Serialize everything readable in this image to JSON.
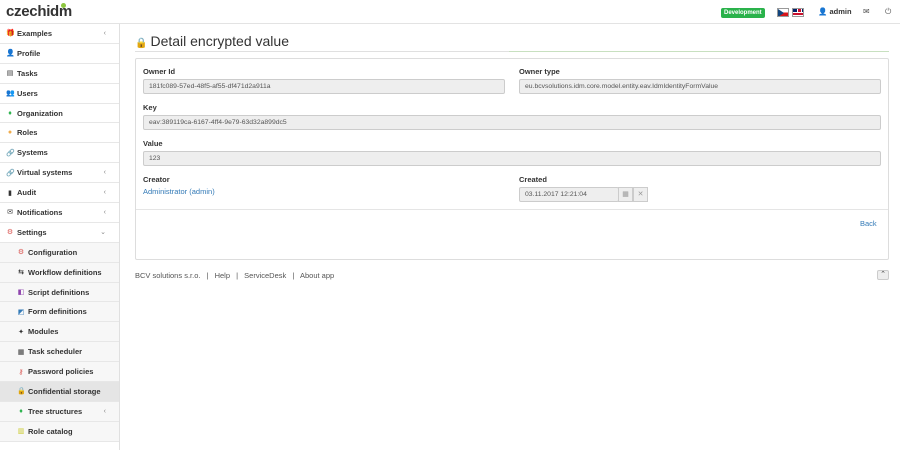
{
  "brand": {
    "logo_text": "czechidm"
  },
  "header": {
    "environment_badge": "Development",
    "user": "admin"
  },
  "sidebar": {
    "items": [
      {
        "label": "Examples",
        "icon": "gift-icon",
        "chevron": "‹"
      },
      {
        "label": "Profile",
        "icon": "user-icon",
        "chevron": ""
      },
      {
        "label": "Tasks",
        "icon": "tasks-icon",
        "chevron": ""
      },
      {
        "label": "Users",
        "icon": "users-icon",
        "chevron": ""
      },
      {
        "label": "Organization",
        "icon": "tree-icon",
        "chevron": ""
      },
      {
        "label": "Roles",
        "icon": "role-icon",
        "chevron": ""
      },
      {
        "label": "Systems",
        "icon": "link-icon",
        "chevron": ""
      },
      {
        "label": "Virtual systems",
        "icon": "link-icon",
        "chevron": "‹"
      },
      {
        "label": "Audit",
        "icon": "chart-icon",
        "chevron": "‹"
      },
      {
        "label": "Notifications",
        "icon": "envelope-icon",
        "chevron": "‹"
      },
      {
        "label": "Settings",
        "icon": "gear-icon",
        "chevron": "⌄"
      }
    ],
    "subitems": [
      {
        "label": "Configuration",
        "icon": "gear-icon",
        "chevron": ""
      },
      {
        "label": "Workflow definitions",
        "icon": "workflow-icon",
        "chevron": ""
      },
      {
        "label": "Script definitions",
        "icon": "script-icon",
        "chevron": ""
      },
      {
        "label": "Form definitions",
        "icon": "form-icon",
        "chevron": ""
      },
      {
        "label": "Modules",
        "icon": "puzzle-icon",
        "chevron": ""
      },
      {
        "label": "Task scheduler",
        "icon": "calendar-icon",
        "chevron": ""
      },
      {
        "label": "Password policies",
        "icon": "key-icon",
        "chevron": ""
      },
      {
        "label": "Confidential storage",
        "icon": "lock-icon",
        "chevron": ""
      },
      {
        "label": "Tree structures",
        "icon": "tree-icon",
        "chevron": "‹"
      },
      {
        "label": "Role catalog",
        "icon": "catalog-icon",
        "chevron": ""
      }
    ]
  },
  "page": {
    "title": "Detail encrypted value"
  },
  "form": {
    "owner_id_label": "Owner Id",
    "owner_id_value": "181fc089-57ed-48f5-af55-df471d2a911a",
    "owner_type_label": "Owner type",
    "owner_type_value": "eu.bcvsolutions.idm.core.model.entity.eav.IdmIdentityFormValue",
    "key_label": "Key",
    "key_value": "eav:389119ca-6167-4ff4-9e79-63d32a899dc5",
    "value_label": "Value",
    "value_value": "123",
    "creator_label": "Creator",
    "creator_value": "Administrator (admin)",
    "created_label": "Created",
    "created_value": "03.11.2017 12:21:04",
    "back_label": "Back"
  },
  "footer": {
    "company": "BCV solutions s.r.o.",
    "sep": "|",
    "help": "Help",
    "servicedesk": "ServiceDesk",
    "about": "About app"
  }
}
